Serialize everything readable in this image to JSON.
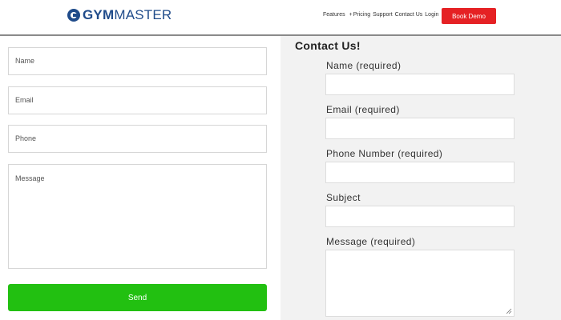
{
  "header": {
    "logo_gym": "GYM",
    "logo_master": "MASTER",
    "nav": {
      "features": "Features",
      "plus": "+",
      "pricing": "Pricing",
      "support": "Support",
      "contact": "Contact Us",
      "login": "Login"
    },
    "book_demo": "Book Demo"
  },
  "left_form": {
    "name_placeholder": "Name",
    "email_placeholder": "Email",
    "phone_placeholder": "Phone",
    "message_placeholder": "Message",
    "send_label": "Send"
  },
  "right_form": {
    "title": "Contact Us!",
    "name_label": "Name (required)",
    "email_label": "Email (required)",
    "phone_label": "Phone Number (required)",
    "subject_label": "Subject",
    "message_label": "Message (required)"
  },
  "colors": {
    "brand_blue": "#1f4b8a",
    "book_demo_red": "#e52124",
    "send_green": "#22c011"
  }
}
